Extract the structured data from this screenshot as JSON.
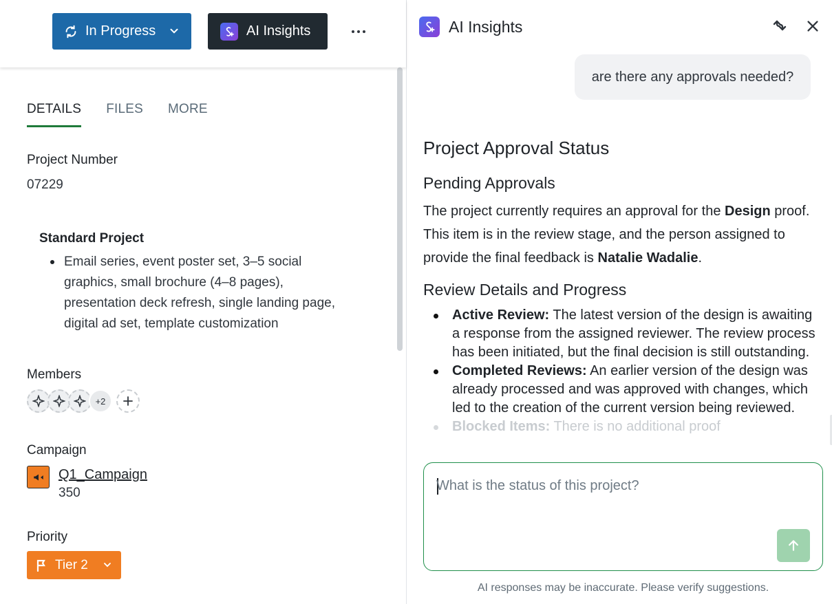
{
  "toolbar": {
    "status_label": "In Progress",
    "ai_label": "AI Insights",
    "more_label": "..."
  },
  "tabs": [
    {
      "label": "DETAILS",
      "active": true
    },
    {
      "label": "FILES",
      "active": false
    },
    {
      "label": "MORE",
      "active": false
    }
  ],
  "details": {
    "project_number_label": "Project Number",
    "project_number": "07229",
    "project_type": "Standard Project",
    "project_scope": "Email series, event poster set, 3–5 social graphics, small brochure (4–8 pages), presentation deck refresh, single landing page, digital ad set, template customization",
    "members_label": "Members",
    "members_extra": "+2",
    "campaign_label": "Campaign",
    "campaign_name": "Q1_Campaign",
    "campaign_number": "350",
    "priority_label": "Priority",
    "priority_value": "Tier 2"
  },
  "ai_panel": {
    "title": "AI Insights",
    "user_question": "are there any approvals needed?",
    "answer_title": "Project Approval Status",
    "section1_heading": "Pending Approvals",
    "section1_text_a": "The project currently requires an approval for the ",
    "section1_bold_a": "Design",
    "section1_text_b": " proof. This item is in the review stage, and the person assigned to provide the final feedback is ",
    "section1_bold_b": "Natalie Wadalie",
    "section1_text_c": ".",
    "section2_heading": "Review Details and Progress",
    "bullets": [
      {
        "bold": "Active Review:",
        "text": " The latest version of the design is awaiting a response from the assigned reviewer. The review process has been initiated, but the final decision is still outstanding."
      },
      {
        "bold": "Completed Reviews:",
        "text": " An earlier version of the design was already processed and was approved with changes, which led to the creation of the current version being reviewed."
      },
      {
        "bold": "Blocked Items:",
        "text": " There is no additional proof"
      }
    ],
    "input_placeholder": "What is the status of this project?",
    "disclaimer": "AI responses may be inaccurate. Please verify suggestions."
  },
  "colors": {
    "status_button": "#1d69a8",
    "ai_button": "#212a31",
    "priority_button": "#f07d22",
    "active_tab_underline": "#1f7a3a",
    "send_button": "#9fd3ae"
  },
  "icons": [
    "sync-icon",
    "chevron-down-icon",
    "ai-logo-icon",
    "more-icon",
    "swap-icon",
    "close-icon",
    "sparkle-icon",
    "plus-icon",
    "megaphone-icon",
    "flag-icon",
    "arrow-up-icon"
  ]
}
